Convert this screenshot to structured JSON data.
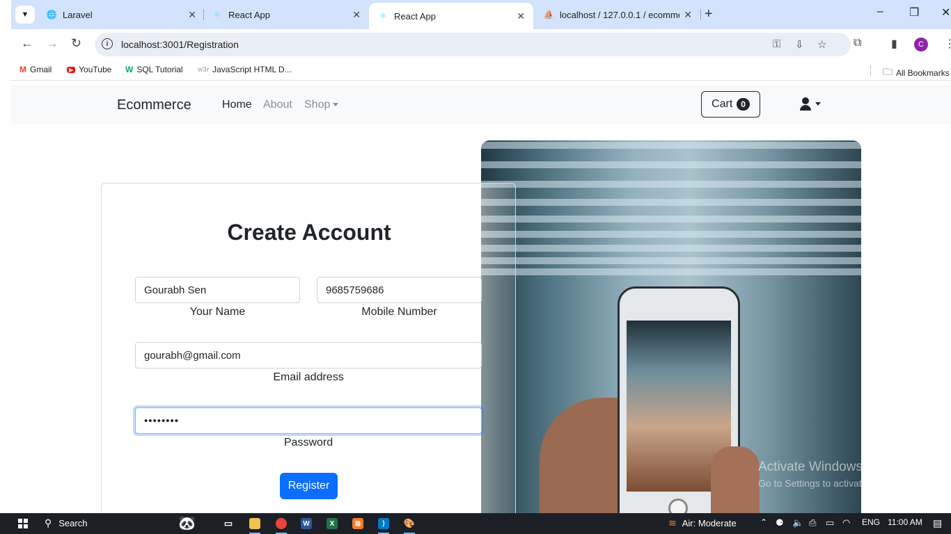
{
  "browser": {
    "tabs": [
      {
        "title": "Laravel",
        "favicon": "globe-icon"
      },
      {
        "title": "React App",
        "favicon": "react-icon"
      },
      {
        "title": "React App",
        "favicon": "react-icon",
        "active": true
      },
      {
        "title": "localhost / 127.0.0.1 / ecommer",
        "favicon": "phpmyadmin-icon"
      }
    ],
    "url": "localhost:3001/Registration",
    "profile_initial": "C",
    "bookmarks": [
      "Gmail",
      "YouTube",
      "SQL Tutorial",
      "JavaScript HTML D..."
    ],
    "all_bookmarks_label": "All Bookmarks"
  },
  "navbar": {
    "brand": "Ecommerce",
    "links": [
      "Home",
      "About",
      "Shop"
    ],
    "cart_label": "Cart",
    "cart_count": "0"
  },
  "form": {
    "title": "Create Account",
    "name_value": "Gourabh Sen",
    "name_label": "Your Name",
    "mobile_value": "9685759686",
    "mobile_label": "Mobile Number",
    "email_value": "gourabh@gmail.com",
    "email_label": "Email address",
    "password_value": "qwerty12",
    "password_label": "Password",
    "submit_label": "Register"
  },
  "watermark": {
    "line1": "Activate Windows",
    "line2": "Go to Settings to activate Windows."
  },
  "taskbar": {
    "search_label": "Search",
    "weather": "Air: Moderate",
    "language": "ENG",
    "time": "11:00 AM"
  },
  "colors": {
    "primary": "#0d6efd",
    "navbar_bg": "#f8f9fa",
    "tabstrip_bg": "#d3e3fd"
  }
}
